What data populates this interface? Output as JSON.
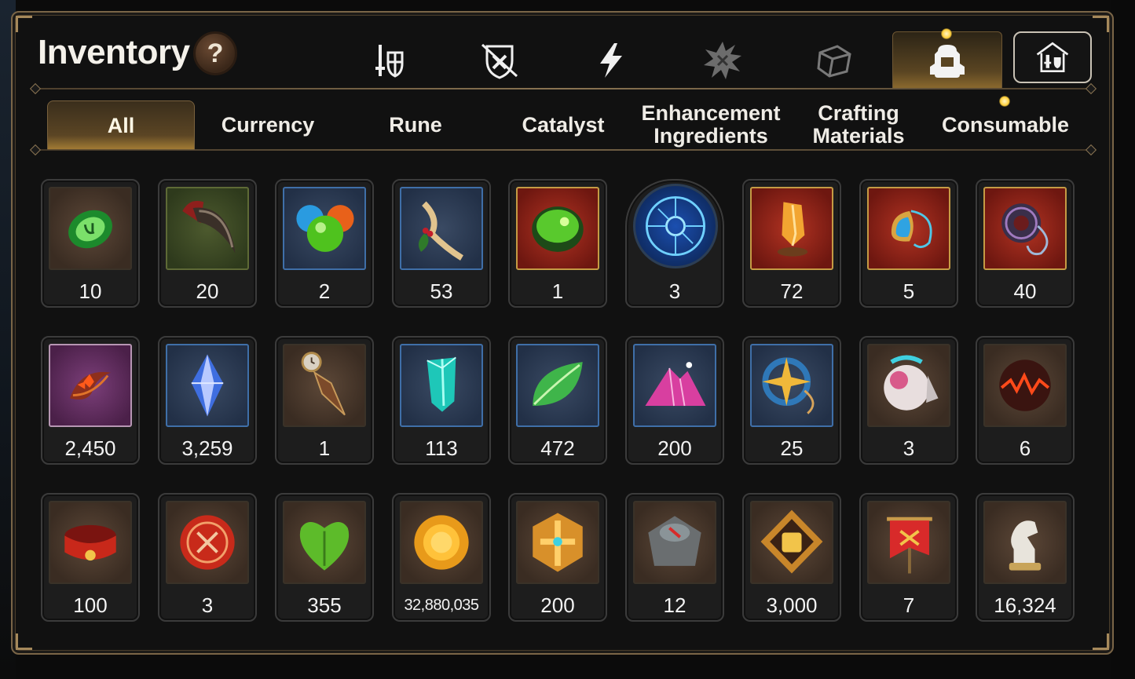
{
  "title": "Inventory",
  "help_label": "?",
  "category_tabs": [
    {
      "icon": "sword-shield-icon",
      "state": "normal"
    },
    {
      "icon": "crossed-out-shield-icon",
      "state": "normal"
    },
    {
      "icon": "lightning-icon",
      "state": "normal"
    },
    {
      "icon": "spiky-emblem-icon",
      "state": "dim"
    },
    {
      "icon": "cube-icon",
      "state": "dim"
    },
    {
      "icon": "backpack-icon",
      "state": "active"
    },
    {
      "icon": "storage-house-icon",
      "state": "boxed"
    }
  ],
  "filter_tabs": [
    {
      "label": "All",
      "active": true
    },
    {
      "label": "Currency",
      "active": false
    },
    {
      "label": "Rune",
      "active": false
    },
    {
      "label": "Catalyst",
      "active": false
    },
    {
      "label": "Enhancement Ingredients",
      "active": false
    },
    {
      "label": "Crafting Materials",
      "active": false
    },
    {
      "label": "Consumable",
      "active": false
    }
  ],
  "items": [
    {
      "icon": "green-rune-stone-icon",
      "count": "10"
    },
    {
      "icon": "beast-claw-icon",
      "count": "20"
    },
    {
      "icon": "colored-orbs-icon",
      "count": "2"
    },
    {
      "icon": "herb-root-icon",
      "count": "53"
    },
    {
      "icon": "green-potion-bowl-icon",
      "count": "1"
    },
    {
      "icon": "blue-circuit-sigil-icon",
      "count": "3"
    },
    {
      "icon": "orange-crystal-icon",
      "count": "72"
    },
    {
      "icon": "blue-gem-pendant-icon",
      "count": "5"
    },
    {
      "icon": "dark-ring-charm-icon",
      "count": "40"
    },
    {
      "icon": "red-flower-crescent-icon",
      "count": "2,450"
    },
    {
      "icon": "blue-crystal-shard-icon",
      "count": "3,259"
    },
    {
      "icon": "bookmark-clock-icon",
      "count": "1"
    },
    {
      "icon": "cyan-crystal-icon",
      "count": "113"
    },
    {
      "icon": "green-leaf-icon",
      "count": "472"
    },
    {
      "icon": "pink-crystal-pile-icon",
      "count": "200"
    },
    {
      "icon": "gold-star-amulet-icon",
      "count": "25"
    },
    {
      "icon": "mechanical-orb-icon",
      "count": "3"
    },
    {
      "icon": "lava-orb-icon",
      "count": "6"
    },
    {
      "icon": "red-bracelet-icon",
      "count": "100"
    },
    {
      "icon": "red-seal-badge-icon",
      "count": "3"
    },
    {
      "icon": "green-heart-icon",
      "count": "355"
    },
    {
      "icon": "gold-sun-coin-icon",
      "count": "32,880,035",
      "small": true
    },
    {
      "icon": "gold-hex-emblem-icon",
      "count": "200"
    },
    {
      "icon": "stone-compass-icon",
      "count": "12"
    },
    {
      "icon": "fist-medal-icon",
      "count": "3,000"
    },
    {
      "icon": "red-war-banner-icon",
      "count": "7"
    },
    {
      "icon": "knight-chess-piece-icon",
      "count": "16,324"
    }
  ],
  "colors": {
    "accent_gold": "#c59b44",
    "panel_border": "#7a6547",
    "text": "#f3f3f3"
  }
}
